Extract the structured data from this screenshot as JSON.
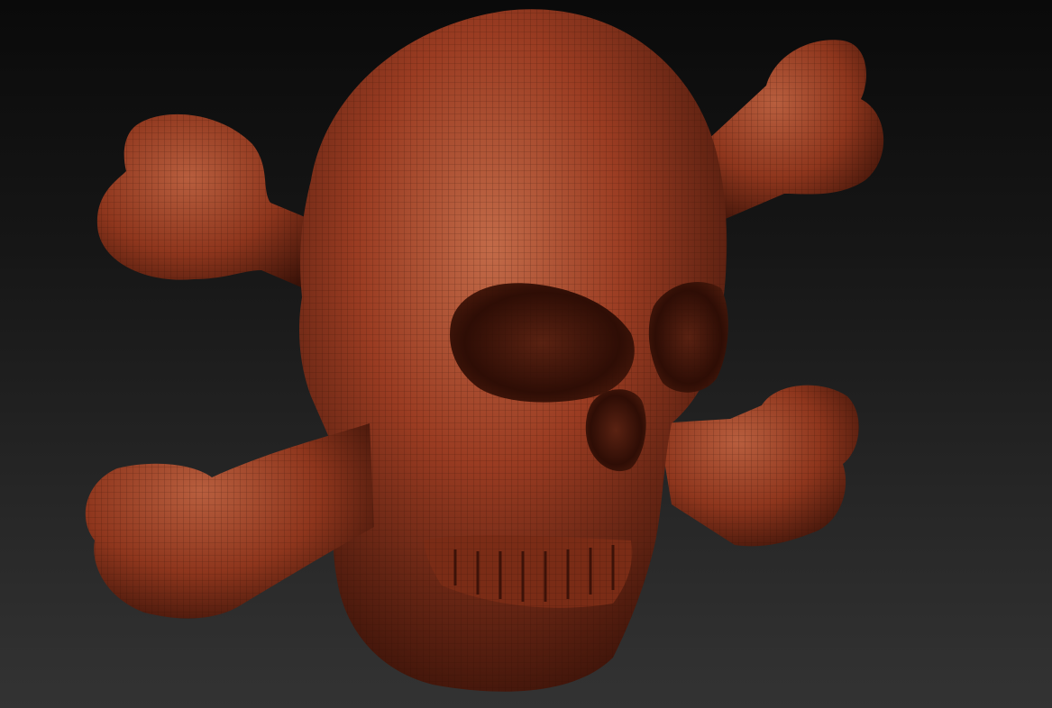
{
  "viewport": {
    "subject": "skull-and-crossbones-mesh",
    "background_top_color": "#0a0a0a",
    "background_bottom_color": "#333333",
    "material_base_color": "#9a3c22",
    "material_highlight_color": "#c06a4a",
    "material_shadow_color": "#3a1208",
    "wireframe_color": "#2a0c04"
  }
}
